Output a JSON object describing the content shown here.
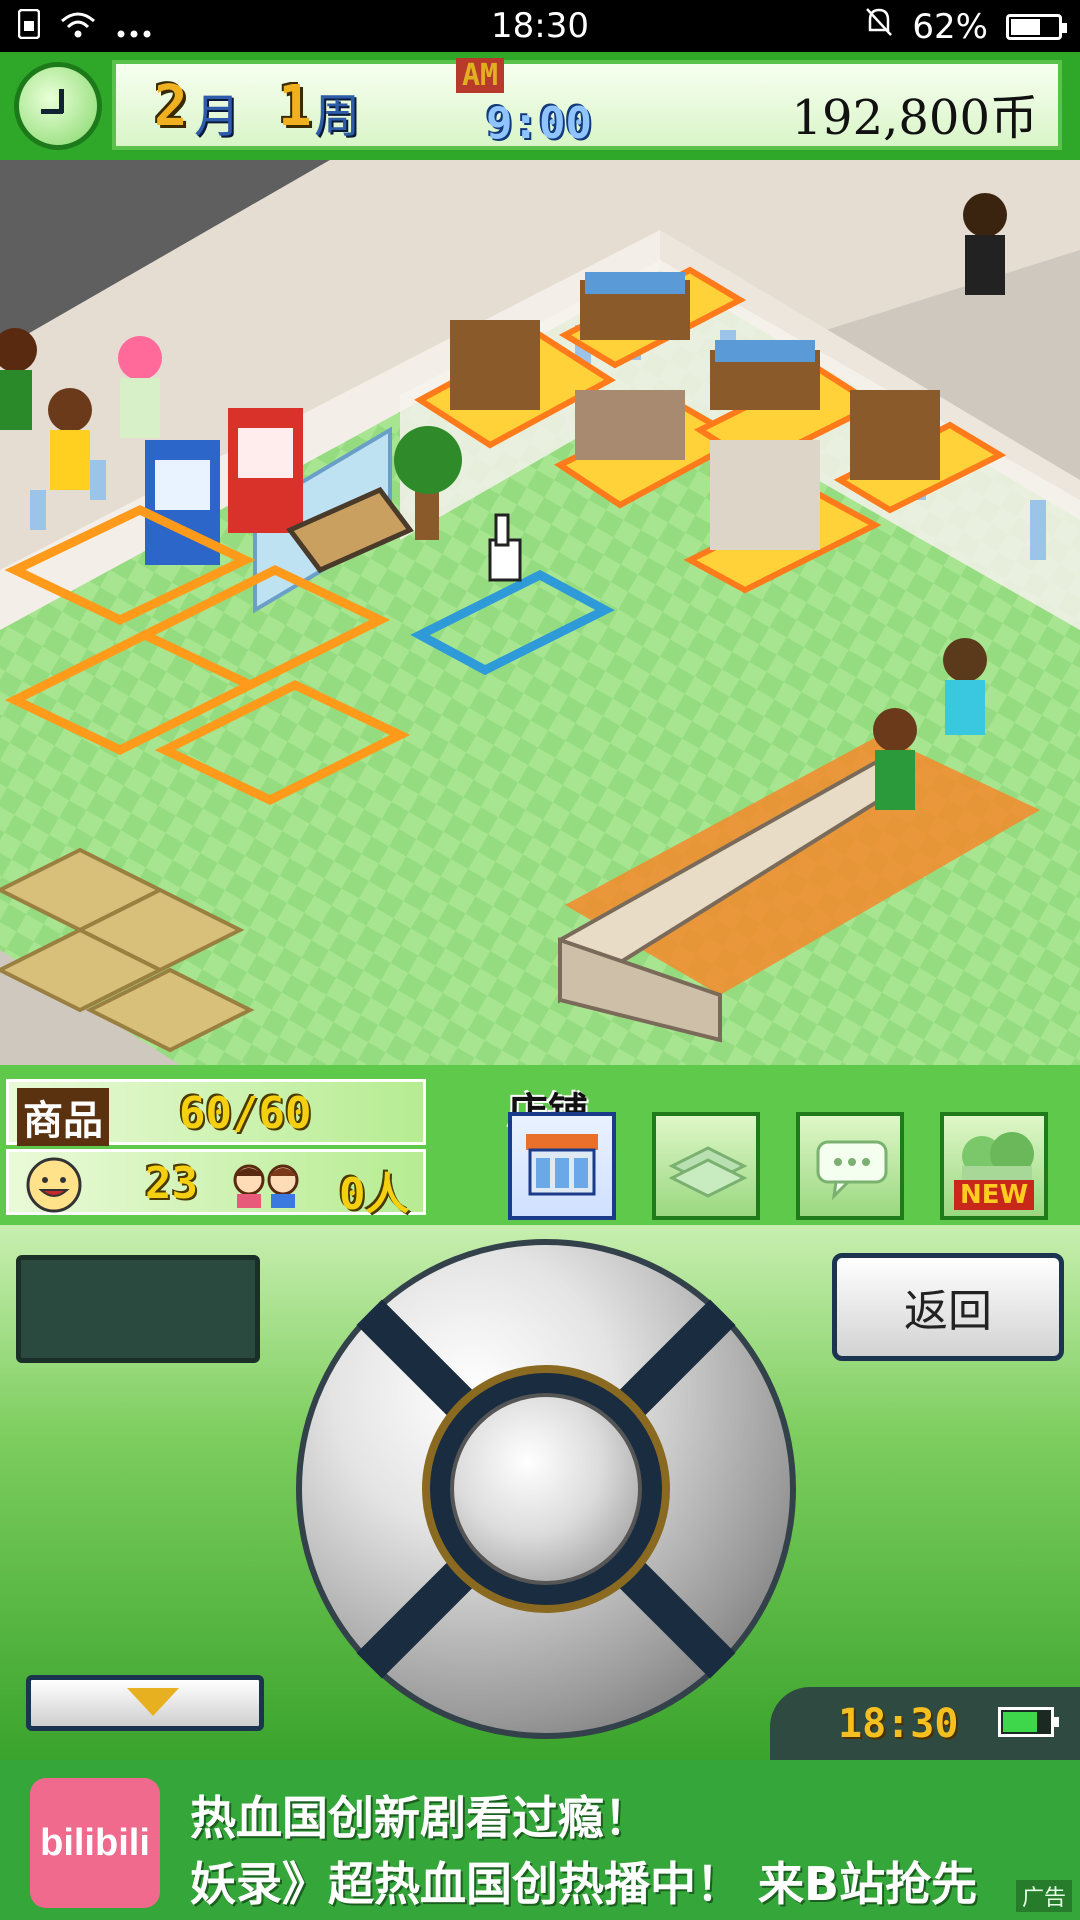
{
  "status_bar": {
    "time": "18:30",
    "battery": "62%",
    "battery_level": 0.62,
    "icons": [
      "sim-icon",
      "wifi-icon",
      "more-icon",
      "alarm-off-icon",
      "battery-icon"
    ]
  },
  "hud": {
    "month_num": "2",
    "month_unit": "月",
    "week_num": "1",
    "week_unit": "周",
    "ampm": "AM",
    "clock": "9:00",
    "money": "192,800币"
  },
  "info": {
    "goods_label": "商品",
    "goods_value": "60/60",
    "smile_value": "23",
    "customers_value": "0人"
  },
  "tabs": {
    "store_label": "店铺",
    "new_badge": "NEW"
  },
  "controls": {
    "back_label": "返回"
  },
  "bottom_clock": {
    "time": "18:30",
    "battery_level": 0.7
  },
  "ad": {
    "logo_text": "bilibili",
    "line1": "热血国创新剧看过瘾！",
    "line2": "妖录》超热血国创热播中！ 来B站抢先",
    "tag": "广告"
  },
  "colors": {
    "hud_green": "#2fa82a",
    "floor_green": "#8fd97c",
    "ad_green": "#35a63a"
  }
}
